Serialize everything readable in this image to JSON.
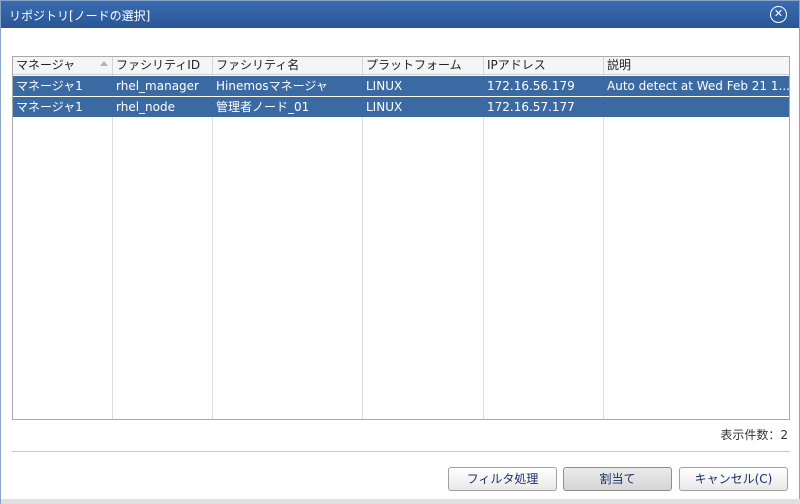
{
  "dialog": {
    "title": "リポジトリ[ノードの選択]",
    "close_glyph": "✕"
  },
  "table": {
    "headers": [
      "マネージャ",
      "ファシリティID",
      "ファシリティ名",
      "プラットフォーム",
      "IPアドレス",
      "説明"
    ],
    "rows": [
      [
        "マネージャ1",
        "rhel_manager",
        "Hinemosマネージャ",
        "LINUX",
        "172.16.56.179",
        "Auto detect at Wed Feb 21 1..."
      ],
      [
        "マネージャ1",
        "rhel_node",
        "管理者ノード_01",
        "LINUX",
        "172.16.57.177",
        ""
      ]
    ],
    "sorted_column": "マネージャ",
    "sort_direction": "ascending"
  },
  "footer": {
    "count_label": "表示件数：2"
  },
  "buttons": {
    "filter": "フィルタ処理",
    "assign": "割当て",
    "cancel": "キャンセル(C)"
  },
  "colors": {
    "titlebar": "#2f5fa3",
    "selected_row": "#3b6aa2"
  }
}
